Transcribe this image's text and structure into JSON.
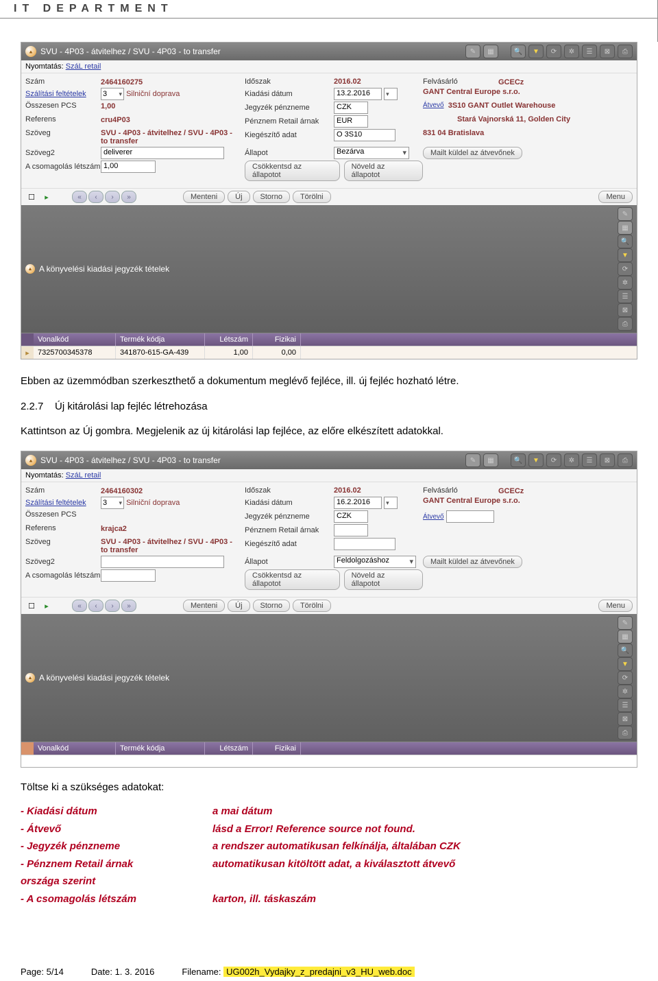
{
  "page_header": "IT DEPARTMENT",
  "screenshot1": {
    "title": "SVU - 4P03 - átvitelhez / SVU - 4P03 - to transfer",
    "print_label": "Nyomtatás:",
    "print_link": "SzáL retail",
    "rows": {
      "szam_lbl": "Szám",
      "szam_val": "2464160275",
      "szall_lbl": "Szálítási feltételek",
      "szall_sel": "3",
      "szall_txt": "Silniční doprava",
      "osszpcs_lbl": "Összesen PCS",
      "osszpcs_val": "1,00",
      "ref_lbl": "Referens",
      "ref_val": "cru4P03",
      "szoveg_lbl": "Szöveg",
      "szoveg_val": "SVU - 4P03 - átvitelhez / SVU - 4P03 - to transfer",
      "szoveg2_lbl": "Szöveg2",
      "szoveg2_val": "deliverer",
      "csom_lbl": "A csomagolás létszám",
      "csom_val": "1,00",
      "idoszak_lbl": "Időszak",
      "idoszak_val": "2016.02",
      "kiad_lbl": "Kiadási dátum",
      "kiad_val": "13.2.2016",
      "jegyp_lbl": "Jegyzék pénzneme",
      "jegyp_val": "CZK",
      "penzr_lbl": "Pénznem Retail árnak",
      "penzr_val": "EUR",
      "kieg_lbl": "Kiegészítő adat",
      "kieg_val": "O 3S10",
      "allapot_lbl": "Állapot",
      "allapot_val": "Bezárva",
      "csokk_btn": "Csökkentsd az állapotot",
      "nov_btn": "Növeld az állapotot",
      "felv_lbl": "Felvásárló",
      "felv_val": "GCECz",
      "comp": "GANT Central Europe s.r.o.",
      "atvevo_link": "Átvevő",
      "addr1": "3S10 GANT Outlet Warehouse",
      "addr2": "Stará Vajnorská 11, Golden City",
      "postal": "831 04  Bratislava",
      "mail_btn": "Mailt küldel az átvevőnek"
    },
    "btns": {
      "menteni": "Menteni",
      "uj": "Új",
      "storno": "Storno",
      "torolni": "Törölni",
      "menu": "Menu"
    },
    "sub_title": "A könyvelési kiadási jegyzék tételek",
    "thead": {
      "c1": "Vonalkód",
      "c2": "Termék kódja",
      "c3": "Létszám",
      "c4": "Fizikai"
    },
    "trow": {
      "c1": "7325700345378",
      "c2": "341870-615-GA-439",
      "c3": "1,00",
      "c4": "0,00"
    }
  },
  "para1": "Ebben az üzemmódban szerkeszthető a dokumentum meglévő fejléce, ill. új fejléc hozható létre.",
  "heading_num": "2.2.7",
  "heading_txt": "Új kitárolási lap fejléc létrehozása",
  "para2": "Kattintson az Új gombra. Megjelenik az új kitárolási lap fejléce, az előre elkészített adatokkal.",
  "screenshot2": {
    "title": "SVU - 4P03 - átvitelhez / SVU - 4P03 - to transfer",
    "print_label": "Nyomtatás:",
    "print_link": "SzáL retail",
    "rows": {
      "szam_lbl": "Szám",
      "szam_val": "2464160302",
      "szall_lbl": "Szálítási feltételek",
      "szall_sel": "3",
      "szall_txt": "Silniční doprava",
      "osszpcs_lbl": "Összesen PCS",
      "osszpcs_val": "",
      "ref_lbl": "Referens",
      "ref_val": "krajca2",
      "szoveg_lbl": "Szöveg",
      "szoveg_val": "SVU - 4P03 - átvitelhez / SVU - 4P03 - to transfer",
      "szoveg2_lbl": "Szöveg2",
      "szoveg2_val": "",
      "csom_lbl": "A csomagolás létszám",
      "csom_val": "",
      "idoszak_lbl": "Időszak",
      "idoszak_val": "2016.02",
      "kiad_lbl": "Kiadási dátum",
      "kiad_val": "16.2.2016",
      "jegyp_lbl": "Jegyzék pénzneme",
      "jegyp_val": "CZK",
      "penzr_lbl": "Pénznem Retail árnak",
      "penzr_val": "",
      "kieg_lbl": "Kiegészítő adat",
      "kieg_val": "",
      "allapot_lbl": "Állapot",
      "allapot_val": "Feldolgozáshoz",
      "csokk_btn": "Csökkentsd az állapotot",
      "nov_btn": "Növeld az állapotot",
      "felv_lbl": "Felvásárló",
      "felv_val": "GCECz",
      "comp": "GANT Central Europe s.r.o.",
      "atvevo_link": "Átvevő",
      "mail_btn": "Mailt küldel az átvevőnek"
    },
    "btns": {
      "menteni": "Menteni",
      "uj": "Új",
      "storno": "Storno",
      "torolni": "Törölni",
      "menu": "Menu"
    },
    "sub_title": "A könyvelési kiadási jegyzék tételek",
    "thead": {
      "c1": "Vonalkód",
      "c2": "Termék kódja",
      "c3": "Létszám",
      "c4": "Fizikai"
    }
  },
  "fill_intro": "Töltse ki a szükséges adatokat:",
  "fill": [
    {
      "l": "- Kiadási dátum",
      "r": "a mai dátum"
    },
    {
      "l": "- Átvevő",
      "r": "lásd a Error! Reference source not found."
    },
    {
      "l": "- Jegyzék pénzneme",
      "r": "a rendszer automatikusan felkínálja, általában CZK"
    },
    {
      "l": "- Pénznem Retail árnak",
      "r": "automatikusan kitöltött adat, a kiválasztott átvevő"
    },
    {
      "l": "országa szerint",
      "r": ""
    },
    {
      "l": "- A csomagolás létszám",
      "r": "karton, ill. táskaszám"
    }
  ],
  "footer": {
    "page": "Page: 5/14",
    "date": "Date: 1. 3. 2016",
    "file_lbl": "Filename: ",
    "file_val": "UG002h_Vydajky_z_predajni_v3_HU_web.doc"
  }
}
